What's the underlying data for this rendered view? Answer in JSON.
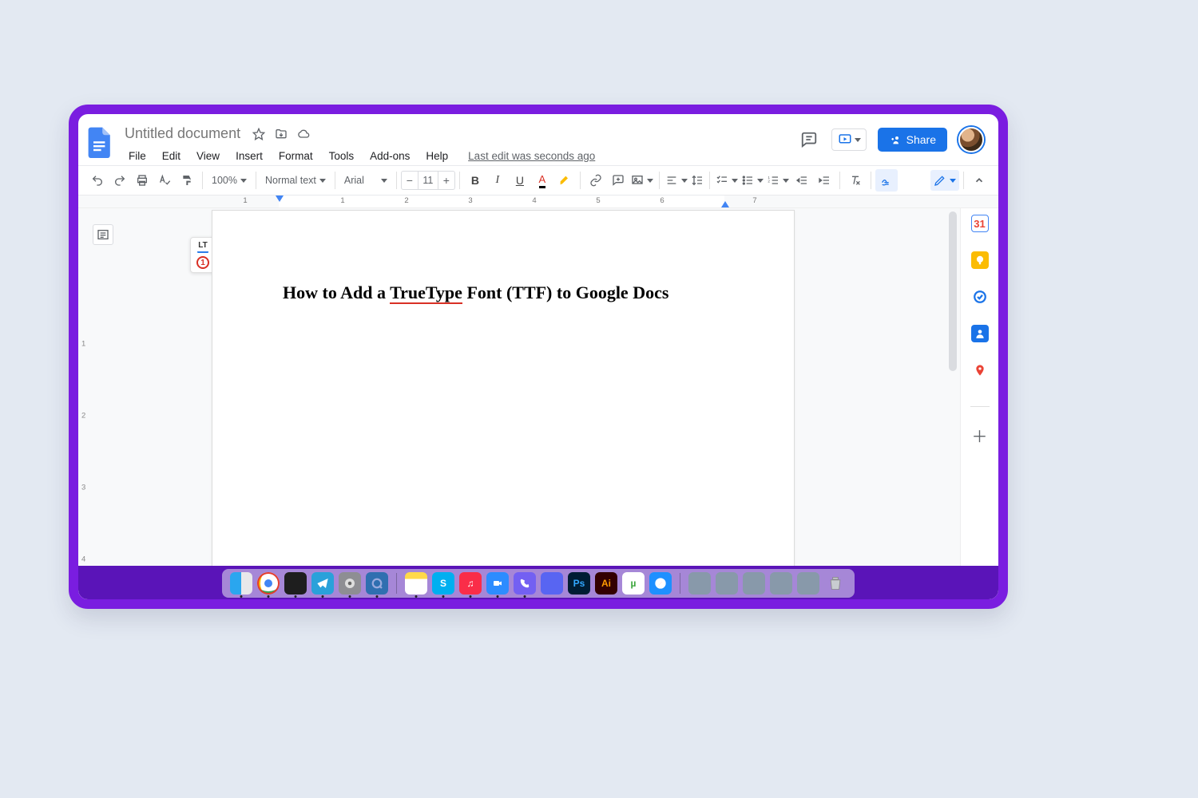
{
  "header": {
    "doc_name": "Untitled document",
    "last_edit": "Last edit was seconds ago",
    "share_label": "Share"
  },
  "menu": {
    "file": "File",
    "edit": "Edit",
    "view": "View",
    "insert": "Insert",
    "format": "Format",
    "tools": "Tools",
    "addons": "Add-ons",
    "help": "Help"
  },
  "toolbar": {
    "zoom": "100%",
    "style": "Normal text",
    "font": "Arial",
    "font_size": "11"
  },
  "ruler": {
    "marks": [
      "1",
      "1",
      "2",
      "3",
      "4",
      "5",
      "6",
      "7"
    ]
  },
  "document": {
    "heading_pre": "How to Add a ",
    "heading_redline": "TrueType",
    "heading_post": " Font (TTF) to Google Docs"
  },
  "lt": {
    "label": "LT",
    "count": "1"
  },
  "sidepanel": {
    "calendar": "31"
  },
  "dock": {
    "apps": [
      "finder",
      "chrome",
      "figma",
      "telegram",
      "settings",
      "qt",
      "notes",
      "skype",
      "music",
      "zoom",
      "viber",
      "discord",
      "ps",
      "ai",
      "ut",
      "safari"
    ],
    "ps_label": "Ps",
    "ai_label": "Ai",
    "ut_label": "µ"
  }
}
